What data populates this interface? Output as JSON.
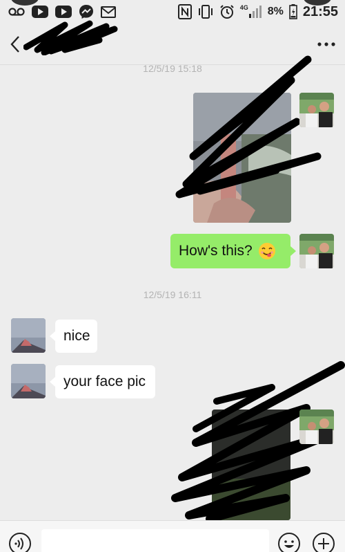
{
  "status_bar": {
    "notification_icons": [
      "voicemail-icon",
      "youtube-icon",
      "youtube-icon",
      "messenger-icon",
      "gmail-icon"
    ],
    "network": "4G",
    "battery": "8%",
    "time": "21:55"
  },
  "header": {
    "contact_name": "",
    "more_label": "···"
  },
  "messages": {
    "timestamp_1": "12/5/19 15:18",
    "outgoing_text": "How's this?",
    "timestamp_2": "12/5/19 16:11",
    "incoming_1": "nice",
    "incoming_2": "your face pic"
  },
  "input": {
    "placeholder": ""
  },
  "colors": {
    "outgoing_bubble": "#95ec69",
    "incoming_bubble": "#ffffff",
    "background": "#ededed"
  }
}
